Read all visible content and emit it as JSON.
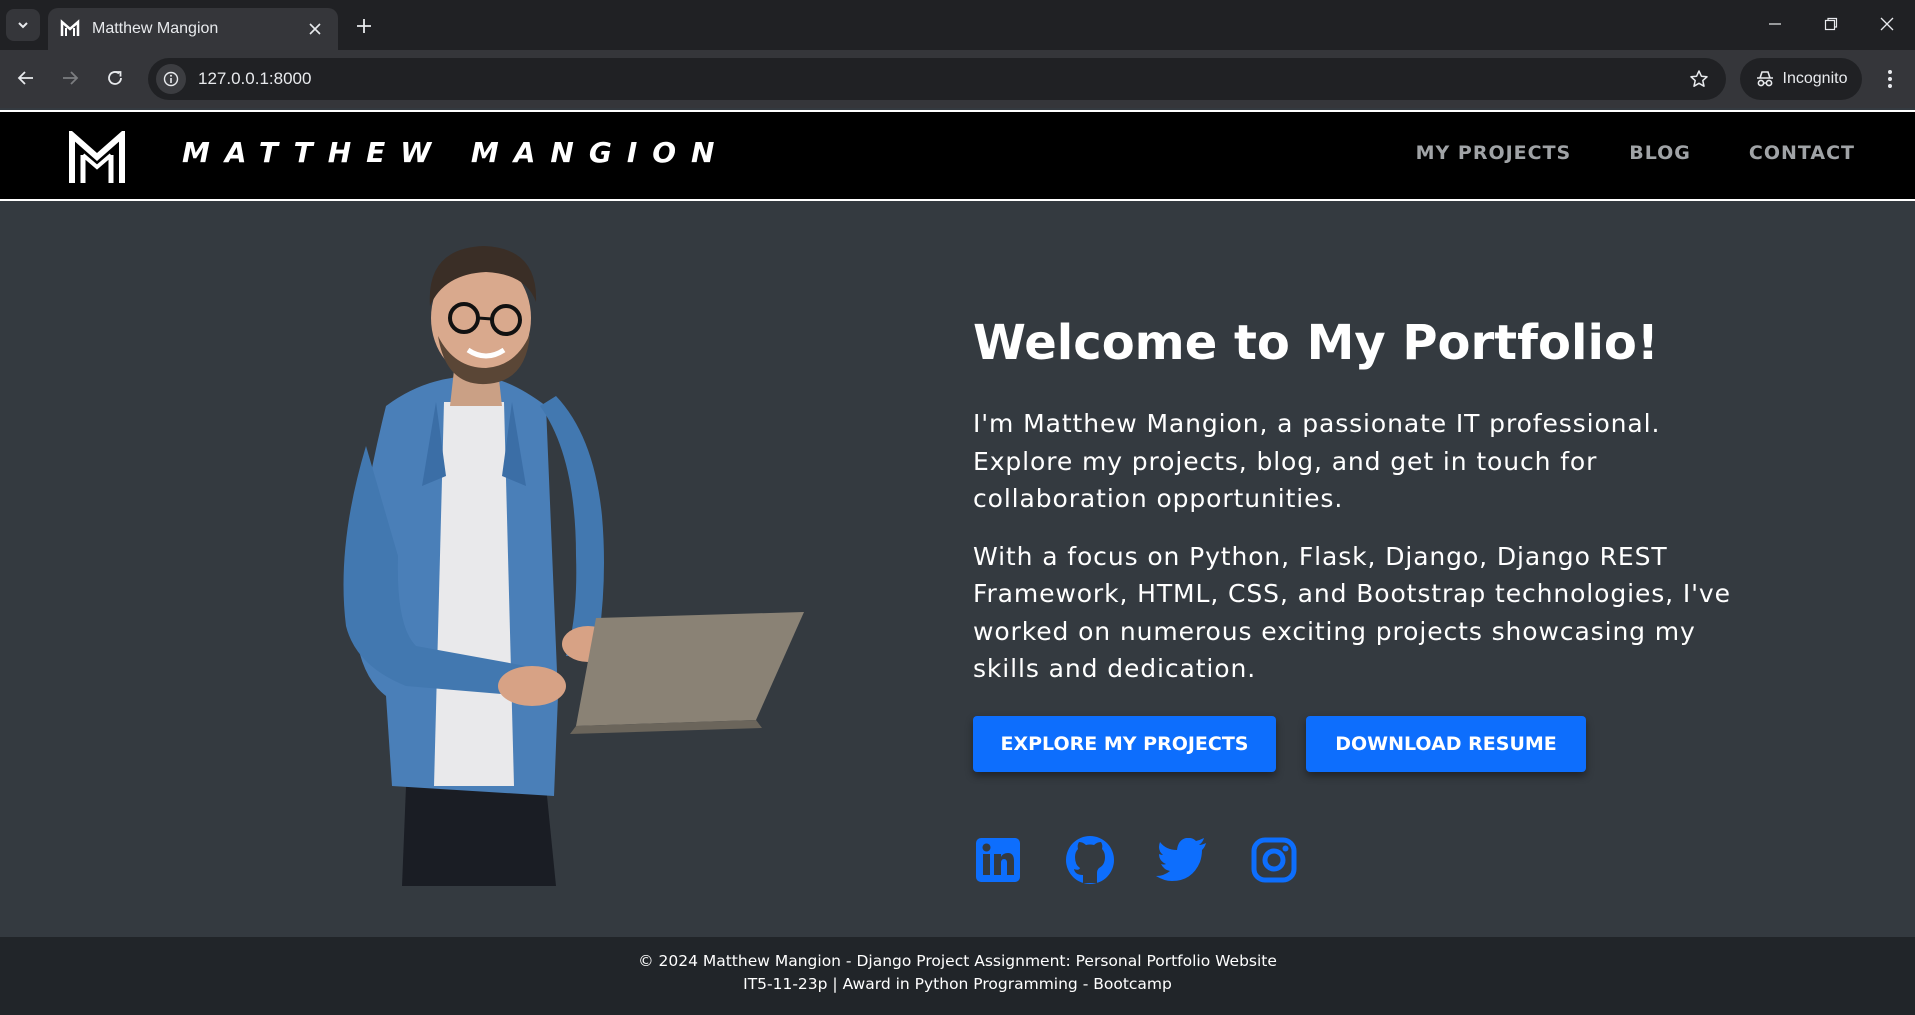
{
  "browser": {
    "tab_title": "Matthew Mangion",
    "url": "127.0.0.1:8000",
    "profile_label": "Incognito"
  },
  "site": {
    "brand_name": "MATTHEW MANGION",
    "nav": [
      {
        "label": "MY PROJECTS"
      },
      {
        "label": "BLOG"
      },
      {
        "label": "CONTACT"
      }
    ]
  },
  "hero": {
    "title": "Welcome to My Portfolio!",
    "paragraph1": "I'm Matthew Mangion, a passionate IT professional. Explore my projects, blog, and get in touch for collaboration opportunities.",
    "paragraph2": "With a focus on Python, Flask, Django, Django REST Framework, HTML, CSS, and Bootstrap technologies, I've worked on numerous exciting projects showcasing my skills and dedication.",
    "buttons": [
      {
        "label": "EXPLORE MY PROJECTS"
      },
      {
        "label": "DOWNLOAD RESUME"
      }
    ],
    "socials": [
      "linkedin-icon",
      "github-icon",
      "twitter-icon",
      "instagram-icon"
    ]
  },
  "footer": {
    "line1": "© 2024 Matthew Mangion - Django Project Assignment: Personal Portfolio Website",
    "line2": "IT5-11-23p | Award in Python Programming - Bootcamp"
  },
  "colors": {
    "accent": "#0d6efd",
    "page_bg": "#343a40",
    "nav_bg": "#000000",
    "footer_bg": "#212529"
  }
}
